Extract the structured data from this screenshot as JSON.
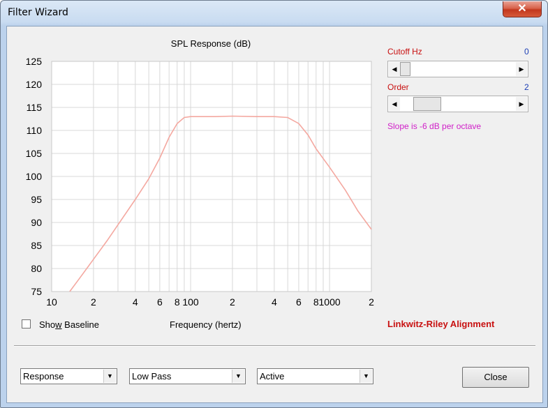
{
  "window": {
    "title": "Filter Wizard",
    "close_glyph": "✕"
  },
  "chart_data": {
    "type": "line",
    "title": "SPL Response (dB)",
    "xlabel": "Frequency (hertz)",
    "ylabel": "",
    "x_scale": "log",
    "xlim": [
      10,
      2000
    ],
    "ylim": [
      75,
      125
    ],
    "grid": true,
    "x_tick_labels": [
      {
        "x": 10,
        "label": "10"
      },
      {
        "x": 20,
        "label": "2"
      },
      {
        "x": 40,
        "label": "4"
      },
      {
        "x": 60,
        "label": "6"
      },
      {
        "x": 80,
        "label": "8"
      },
      {
        "x": 100,
        "label": "100"
      },
      {
        "x": 200,
        "label": "2"
      },
      {
        "x": 400,
        "label": "4"
      },
      {
        "x": 600,
        "label": "6"
      },
      {
        "x": 800,
        "label": "8"
      },
      {
        "x": 1000,
        "label": "1000"
      },
      {
        "x": 2000,
        "label": "2"
      }
    ],
    "y_ticks": [
      75,
      80,
      85,
      90,
      95,
      100,
      105,
      110,
      115,
      120,
      125
    ],
    "series": [
      {
        "color": "#f4a8a0",
        "x": [
          13.5,
          16,
          20,
          25,
          30,
          40,
          50,
          60,
          70,
          80,
          90,
          100,
          150,
          200,
          300,
          400,
          500,
          600,
          700,
          800,
          1000,
          1300,
          1600,
          2000
        ],
        "y": [
          75,
          78,
          82,
          86,
          89.5,
          95,
          99.5,
          104,
          108.5,
          111.5,
          112.8,
          113,
          113,
          113.1,
          113,
          113,
          112.8,
          111.5,
          109,
          106,
          102,
          97,
          92.5,
          88.5
        ]
      }
    ]
  },
  "cutoff": {
    "label": "Cutoff  Hz",
    "value": "0",
    "thumb_fraction": 0.0
  },
  "order": {
    "label": "Order",
    "value": "2",
    "thumb_fraction": 0.15
  },
  "slope_text": "Slope is -6 dB per octave",
  "alignment_text": "Linkwitz-Riley Alignment",
  "baseline": {
    "label_pre": "Sho",
    "label_accel": "w",
    "label_post": " Baseline",
    "checked": false
  },
  "combos": {
    "mode": "Response",
    "filter_type": "Low Pass",
    "circuit": "Active"
  },
  "close_button": "Close",
  "colors": {
    "cutoff_value": "#1c3eb5",
    "label_red": "#c81010",
    "slope_magenta": "#d020c8",
    "curve": "#f4a8a0"
  }
}
